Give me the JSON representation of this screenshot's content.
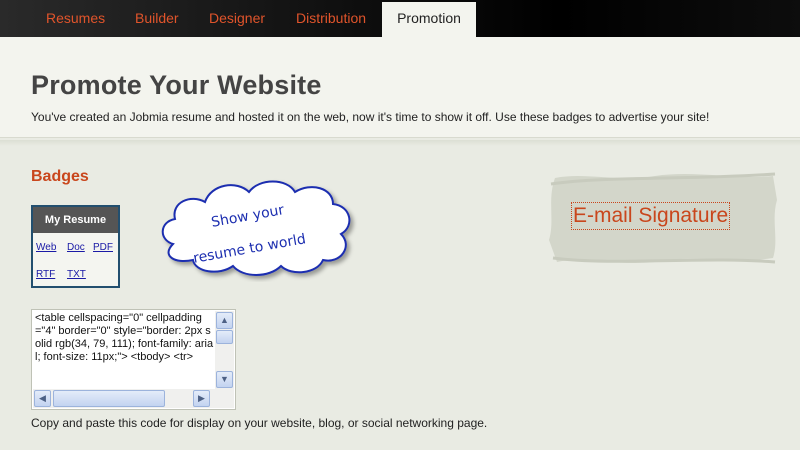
{
  "nav": {
    "tabs": [
      {
        "label": "Resumes",
        "active": false
      },
      {
        "label": "Builder",
        "active": false
      },
      {
        "label": "Designer",
        "active": false
      },
      {
        "label": "Distribution",
        "active": false
      },
      {
        "label": "Promotion",
        "active": true
      }
    ]
  },
  "header": {
    "title": "Promote Your Website",
    "intro": "You've created an Jobmia resume and hosted it on the web, now it's time to show it off. Use these badges to advertise your site!"
  },
  "badges": {
    "section_title": "Badges",
    "badge_title": "My Resume",
    "links": [
      "Web",
      "Doc",
      "PDF",
      "RTF",
      "TXT"
    ]
  },
  "callout": {
    "line1": "Show your",
    "line2": "resume to world"
  },
  "email_signature": {
    "label": "E-mail Signature"
  },
  "code": {
    "snippet": "<table cellspacing=\"0\" cellpadding=\"4\" border=\"0\" style=\"border: 2px solid rgb(34, 79, 111); font-family: arial; font-size: 11px;\"> <tbody> <tr>",
    "instructions": "Copy and paste this code for display on your website, blog, or social networking page."
  },
  "colors": {
    "accent": "#c9461c",
    "nav_text": "#e0542b",
    "badge_border": "#224f6f",
    "link": "#1a1aa6"
  },
  "icons": {
    "scroll_up": "triangle-up-icon",
    "scroll_down": "triangle-down-icon",
    "scroll_left": "triangle-left-icon",
    "scroll_right": "triangle-right-icon"
  }
}
